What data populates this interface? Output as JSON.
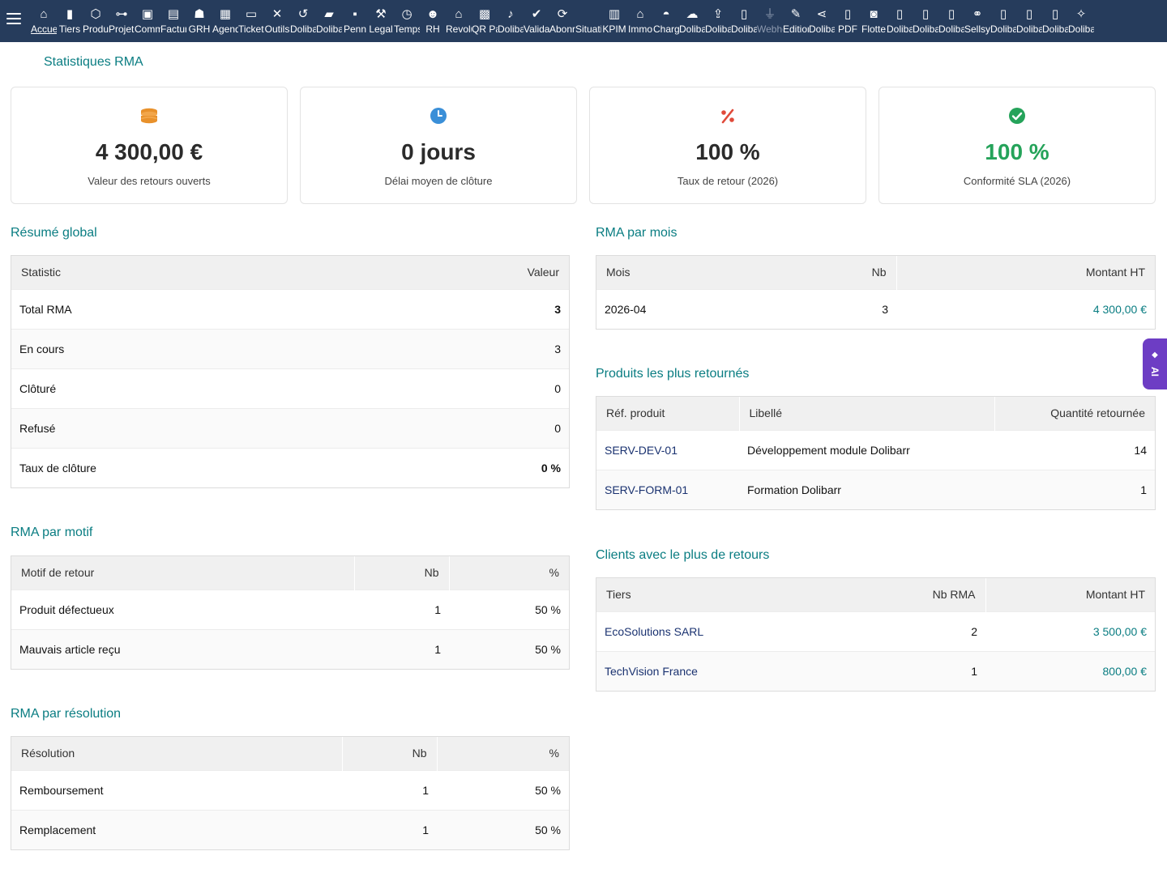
{
  "topbar": {
    "menu": [
      {
        "label": "Accueil",
        "icon": "home-icon",
        "glyph": "⌂",
        "active": true
      },
      {
        "label": "Tiers",
        "icon": "building-icon",
        "glyph": "▮"
      },
      {
        "label": "Produits",
        "icon": "box-icon",
        "glyph": "⬡"
      },
      {
        "label": "Projets",
        "icon": "project-icon",
        "glyph": "⊶"
      },
      {
        "label": "Commerce",
        "icon": "briefcase-icon",
        "glyph": "▣"
      },
      {
        "label": "Facturation",
        "icon": "invoice-icon",
        "glyph": "▤"
      },
      {
        "label": "GRH",
        "icon": "users-icon",
        "glyph": "☗"
      },
      {
        "label": "Agenda",
        "icon": "calendar-icon",
        "glyph": "▦"
      },
      {
        "label": "Tickets",
        "icon": "ticket-icon",
        "glyph": "▭"
      },
      {
        "label": "Outils",
        "icon": "tools-icon",
        "glyph": "✕"
      },
      {
        "label": "Dolibarr",
        "icon": "undo-icon",
        "glyph": "↺"
      },
      {
        "label": "Dolibarr",
        "icon": "case-icon",
        "glyph": "▰"
      },
      {
        "label": "Penn",
        "icon": "stamp-icon",
        "glyph": "▪"
      },
      {
        "label": "Legal",
        "icon": "gavel-icon",
        "glyph": "⚒"
      },
      {
        "label": "Temps",
        "icon": "clock-icon",
        "glyph": "◷"
      },
      {
        "label": "RH",
        "icon": "team-icon",
        "glyph": "☻"
      },
      {
        "label": "Revolut",
        "icon": "bank-icon",
        "glyph": "⌂"
      },
      {
        "label": "QR Pay",
        "icon": "qrcode-icon",
        "glyph": "▩"
      },
      {
        "label": "Dolibarr",
        "icon": "bell-icon",
        "glyph": "♪"
      },
      {
        "label": "Validation",
        "icon": "check-double-icon",
        "glyph": "✔"
      },
      {
        "label": "Abonnements",
        "icon": "refresh-icon",
        "glyph": "⟳"
      },
      {
        "label": "Situation",
        "icon": "blank-icon",
        "glyph": ""
      },
      {
        "label": "KPIM",
        "icon": "bar-chart-icon",
        "glyph": "▥"
      },
      {
        "label": "Immo",
        "icon": "house-icon",
        "glyph": "⌂"
      },
      {
        "label": "Charges",
        "icon": "bell-food-icon",
        "glyph": "◓"
      },
      {
        "label": "Dolibarr",
        "icon": "cloud-icon",
        "glyph": "☁"
      },
      {
        "label": "Dolibarr",
        "icon": "upload-icon",
        "glyph": "⇪"
      },
      {
        "label": "Dolibarr",
        "icon": "tower-icon",
        "glyph": "▯"
      },
      {
        "label": "Webhooks",
        "icon": "plug-icon",
        "glyph": "⏚",
        "dim": true
      },
      {
        "label": "Edition",
        "icon": "edit-icon",
        "glyph": "✎"
      },
      {
        "label": "Dolibarr",
        "icon": "share-icon",
        "glyph": "⋖"
      },
      {
        "label": "PDF",
        "icon": "pdf-icon",
        "glyph": "▯"
      },
      {
        "label": "Flotte",
        "icon": "car-icon",
        "glyph": "◙"
      },
      {
        "label": "Dolibarr",
        "icon": "note-icon",
        "glyph": "▯"
      },
      {
        "label": "Dolibarr",
        "icon": "note-icon",
        "glyph": "▯"
      },
      {
        "label": "Dolibarr",
        "icon": "note-icon",
        "glyph": "▯"
      },
      {
        "label": "Sellsy",
        "icon": "handshake-icon",
        "glyph": "⚭"
      },
      {
        "label": "Dolibarr",
        "icon": "note-icon",
        "glyph": "▯"
      },
      {
        "label": "Dolibarr",
        "icon": "note-icon",
        "glyph": "▯"
      },
      {
        "label": "Dolibarr",
        "icon": "note-icon",
        "glyph": "▯"
      },
      {
        "label": "Dolibarr",
        "icon": "magic-wand-icon",
        "glyph": "✧"
      }
    ]
  },
  "page": {
    "title": "Statistiques RMA"
  },
  "kpis": [
    {
      "value": "4 300,00 €",
      "label": "Valeur des retours ouverts",
      "icon": "coins-icon"
    },
    {
      "value": "0 jours",
      "label": "Délai moyen de clôture",
      "icon": "clock-icon"
    },
    {
      "value": "100 %",
      "label": "Taux de retour (2026)",
      "icon": "percent-icon"
    },
    {
      "value": "100 %",
      "label": "Conformité SLA (2026)",
      "icon": "check-circle-icon"
    }
  ],
  "colors": {
    "accent": "#0a7d82",
    "topbar": "#263c5c",
    "link": "#1a3270",
    "success": "#25a35a",
    "warning": "#e8912b",
    "danger": "#e04a3a",
    "info": "#3a8fd8",
    "ai": "#6d3dc4"
  },
  "summary": {
    "title": "Résumé global",
    "headers": [
      "Statistic",
      "Valeur"
    ],
    "rows": [
      {
        "label": "Total RMA",
        "value": "3"
      },
      {
        "label": "En cours",
        "value": "3"
      },
      {
        "label": "Clôturé",
        "value": "0"
      },
      {
        "label": "Refusé",
        "value": "0"
      },
      {
        "label": "Taux de clôture",
        "value": "0 %"
      }
    ]
  },
  "by_reason": {
    "title": "RMA par motif",
    "headers": [
      "Motif de retour",
      "Nb",
      "%"
    ],
    "rows": [
      {
        "label": "Produit défectueux",
        "nb": "1",
        "pct": "50 %"
      },
      {
        "label": "Mauvais article reçu",
        "nb": "1",
        "pct": "50 %"
      }
    ]
  },
  "by_resolution": {
    "title": "RMA par résolution",
    "headers": [
      "Résolution",
      "Nb",
      "%"
    ],
    "rows": [
      {
        "label": "Remboursement",
        "nb": "1",
        "pct": "50 %"
      },
      {
        "label": "Remplacement",
        "nb": "1",
        "pct": "50 %"
      }
    ]
  },
  "by_month": {
    "title": "RMA par mois",
    "headers": [
      "Mois",
      "Nb",
      "Montant HT"
    ],
    "rows": [
      {
        "month": "2026-04",
        "nb": "3",
        "amount": "4 300,00 €"
      }
    ]
  },
  "top_products": {
    "title": "Produits les plus retournés",
    "headers": [
      "Réf. produit",
      "Libellé",
      "Quantité retournée"
    ],
    "rows": [
      {
        "ref": "SERV-DEV-01",
        "label": "Développement module Dolibarr",
        "qty": "14"
      },
      {
        "ref": "SERV-FORM-01",
        "label": "Formation Dolibarr",
        "qty": "1"
      }
    ]
  },
  "top_clients": {
    "title": "Clients avec le plus de retours",
    "headers": [
      "Tiers",
      "Nb RMA",
      "Montant HT"
    ],
    "rows": [
      {
        "name": "EcoSolutions SARL",
        "nb": "2",
        "amount": "3 500,00 €"
      },
      {
        "name": "TechVision France",
        "nb": "1",
        "amount": "800,00 €"
      }
    ]
  },
  "ai_tab": {
    "label": "AI",
    "icon": "sparkle-icon"
  }
}
